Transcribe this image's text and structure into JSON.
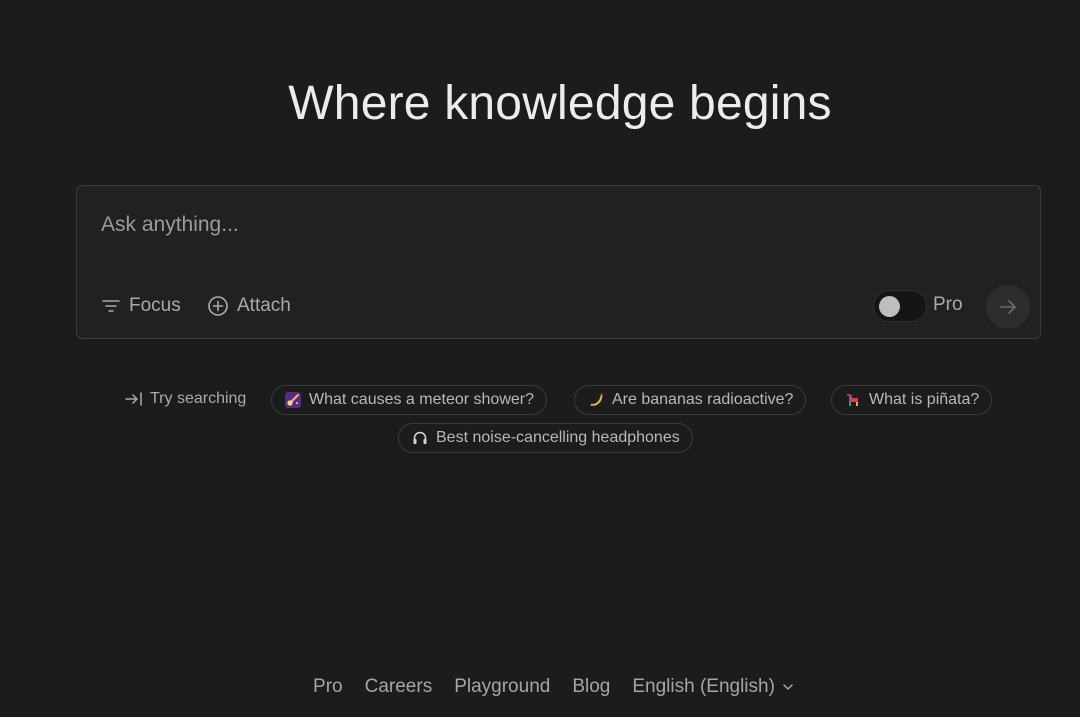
{
  "headline": "Where knowledge begins",
  "search": {
    "placeholder": "Ask anything...",
    "focus_label": "Focus",
    "attach_label": "Attach",
    "pro_label": "Pro",
    "pro_enabled": false
  },
  "suggestions": {
    "label": "Try searching",
    "chips": [
      {
        "icon": "meteor-emoji-icon",
        "text": "What causes a meteor shower?"
      },
      {
        "icon": "banana-emoji-icon",
        "text": "Are bananas radioactive?"
      },
      {
        "icon": "pinata-emoji-icon",
        "text": "What is piñata?"
      },
      {
        "icon": "headphones-icon",
        "text": "Best noise-cancelling headphones"
      }
    ]
  },
  "footer": {
    "links": [
      "Pro",
      "Careers",
      "Playground",
      "Blog"
    ],
    "language": "English (English)"
  },
  "colors": {
    "background": "#1b1c1c",
    "panel": "#202222",
    "border": "#3b3d3d",
    "text": "#e8e8e6",
    "muted": "#a9abab"
  }
}
